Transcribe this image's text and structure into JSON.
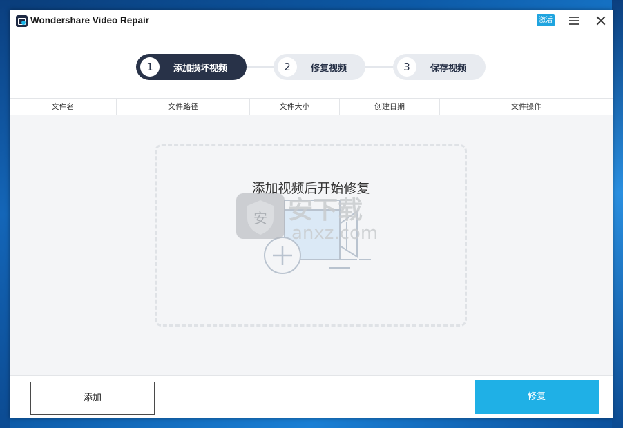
{
  "window": {
    "title": "Wondershare Video Repair",
    "activate_label": "激活"
  },
  "steps": [
    {
      "num": "1",
      "label": "添加损坏视频",
      "state": "active"
    },
    {
      "num": "2",
      "label": "修复视频",
      "state": "inactive"
    },
    {
      "num": "3",
      "label": "保存视频",
      "state": "inactive"
    }
  ],
  "table": {
    "columns": [
      "文件名",
      "文件路径",
      "文件大小",
      "创建日期",
      "文件操作"
    ]
  },
  "drop_zone": {
    "text": "添加视频后开始修复"
  },
  "watermark": {
    "badge": "安",
    "brand": "安下载",
    "domain": "anxz.com"
  },
  "footer": {
    "add_label": "添加",
    "repair_label": "修复"
  },
  "colors": {
    "accent": "#1fb0e6",
    "step_active": "#283248",
    "step_inactive": "#e8ebf0"
  }
}
